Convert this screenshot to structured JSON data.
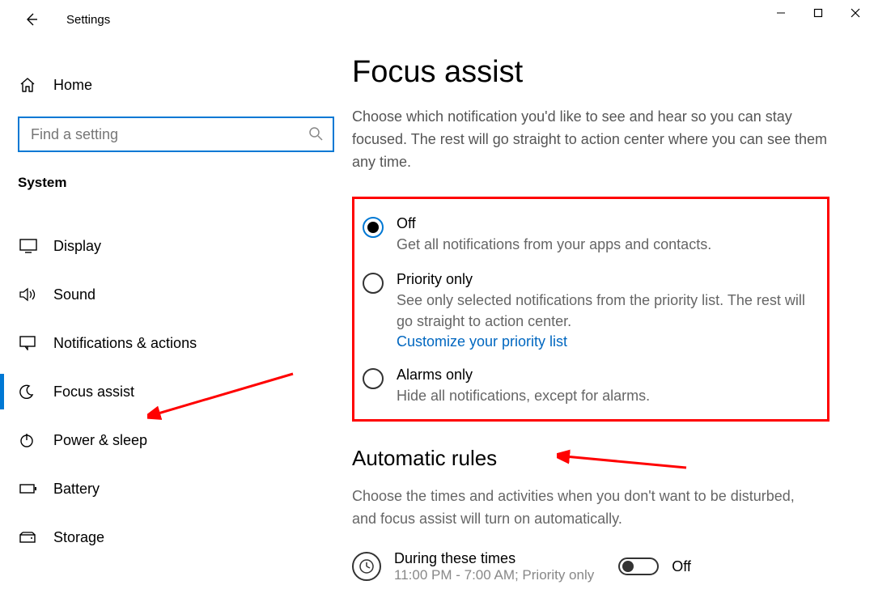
{
  "titlebar": {
    "title": "Settings"
  },
  "sidebar": {
    "home_label": "Home",
    "search_placeholder": "Find a setting",
    "group_label": "System",
    "items": [
      {
        "label": "Display"
      },
      {
        "label": "Sound"
      },
      {
        "label": "Notifications & actions"
      },
      {
        "label": "Focus assist"
      },
      {
        "label": "Power & sleep"
      },
      {
        "label": "Battery"
      },
      {
        "label": "Storage"
      }
    ]
  },
  "main": {
    "title": "Focus assist",
    "description": "Choose which notification you'd like to see and hear so you can stay focused. The rest will go straight to action center where you can see them any time.",
    "options": {
      "off": {
        "label": "Off",
        "desc": "Get all notifications from your apps and contacts."
      },
      "priority": {
        "label": "Priority only",
        "desc": "See only selected notifications from the priority list. The rest will go straight to action center.",
        "link": "Customize your priority list"
      },
      "alarms": {
        "label": "Alarms only",
        "desc": "Hide all notifications, except for alarms."
      }
    },
    "auto_rules": {
      "title": "Automatic rules",
      "desc": "Choose the times and activities when you don't want to be disturbed, and focus assist will turn on automatically.",
      "rule1": {
        "title": "During these times",
        "sub": "11:00 PM - 7:00 AM; Priority only",
        "toggle_label": "Off"
      }
    }
  }
}
